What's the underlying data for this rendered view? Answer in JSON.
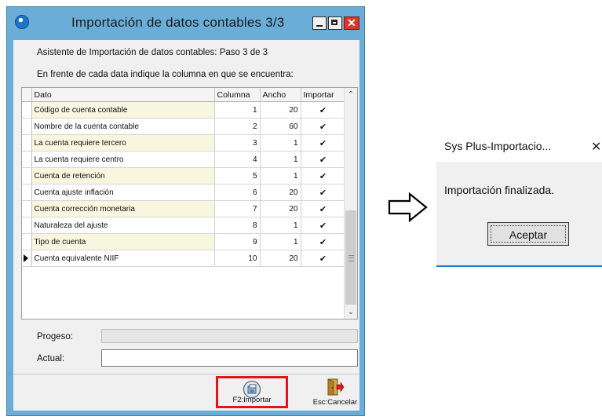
{
  "main_window": {
    "title": "Importación de datos contables 3/3",
    "close_glyph": "✕",
    "step_text": "Asistente de Importación de datos contables: Paso 3 de 3",
    "instruction": "En frente de cada data indique la columna en que se encuentra:",
    "grid": {
      "headers": [
        "Dato",
        "Columna",
        "Ancho",
        "Importar"
      ],
      "rows": [
        {
          "dato": "Código de cuenta contable",
          "columna": "1",
          "ancho": "20",
          "importar": "✔"
        },
        {
          "dato": "Nombre de la cuenta contable",
          "columna": "2",
          "ancho": "60",
          "importar": "✔"
        },
        {
          "dato": "La cuenta requiere tercero",
          "columna": "3",
          "ancho": "1",
          "importar": "✔"
        },
        {
          "dato": "La cuenta requiere centro",
          "columna": "4",
          "ancho": "1",
          "importar": "✔"
        },
        {
          "dato": "Cuenta de retención",
          "columna": "5",
          "ancho": "1",
          "importar": "✔"
        },
        {
          "dato": "Cuenta ajuste inflación",
          "columna": "6",
          "ancho": "20",
          "importar": "✔"
        },
        {
          "dato": "Cuenta corrección monetaria",
          "columna": "7",
          "ancho": "20",
          "importar": "✔"
        },
        {
          "dato": "Naturaleza del ajuste",
          "columna": "8",
          "ancho": "1",
          "importar": "✔"
        },
        {
          "dato": "Tipo de cuenta",
          "columna": "9",
          "ancho": "1",
          "importar": "✔"
        },
        {
          "dato": "Cuenta equivalente NIIF",
          "columna": "10",
          "ancho": "20",
          "importar": "✔"
        }
      ],
      "scroll_up": "⌃",
      "scroll_down": "⌄"
    },
    "progress_label": "Progeso:",
    "actual_label": "Actual:",
    "actual_value": "",
    "import_button": "F2:Importar",
    "cancel_button": "Esc:Cancelar"
  },
  "message_dialog": {
    "title": "Sys Plus-Importacio...",
    "close_glyph": "✕",
    "text": "Importación finalizada.",
    "ok_button": "Aceptar"
  },
  "colors": {
    "title_bar": "#6aaed8",
    "highlight_box": "#e0161b",
    "dialog_accent": "#1f7fd4"
  },
  "icons": [
    "app-info-icon",
    "minimize-icon",
    "maximize-icon",
    "close-icon",
    "import-icon",
    "exit-door-icon",
    "right-arrow-icon",
    "row-indicator-icon"
  ]
}
